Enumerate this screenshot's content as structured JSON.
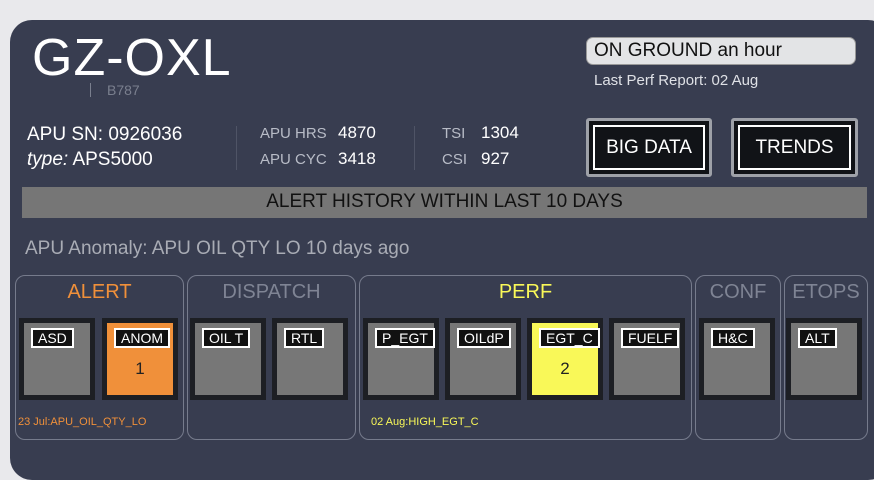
{
  "header": {
    "registration": "GZ-OXL",
    "aircraft_type": "B787",
    "flight_status": "ON GROUND an hour",
    "last_perf_report": "Last Perf Report: 02 Aug"
  },
  "apu": {
    "sn_label": "APU SN:",
    "sn_value": "0926036",
    "type_label": "type:",
    "type_value": "APS5000",
    "hrs_label": "APU HRS",
    "hrs_value": "4870",
    "cyc_label": "APU CYC",
    "cyc_value": "3418",
    "tsi_label": "TSI",
    "tsi_value": "1304",
    "csi_label": "CSI",
    "csi_value": "927"
  },
  "buttons": {
    "big_data": "BIG DATA",
    "trends": "TRENDS"
  },
  "alert_history": {
    "banner": "ALERT HISTORY WITHIN LAST 10 DAYS",
    "anomaly_text": "APU Anomaly: APU OIL QTY LO 10 days ago"
  },
  "groups": {
    "alert": {
      "title": "ALERT",
      "footer": "23 Jul:APU_OIL_QTY_LO",
      "title_color": "#f0903a"
    },
    "dispatch": {
      "title": "DISPATCH"
    },
    "perf": {
      "title": "PERF",
      "footer": "02 Aug:HIGH_EGT_C",
      "title_color": "#f9f858"
    },
    "conf": {
      "title": "CONF"
    },
    "etops": {
      "title": "ETOPS"
    }
  },
  "tiles": {
    "asd": {
      "label": "ASD"
    },
    "anom": {
      "label": "ANOM",
      "count": "1"
    },
    "oil_t": {
      "label": "OIL T"
    },
    "rtl": {
      "label": "RTL"
    },
    "p_egt": {
      "label": "P_EGT"
    },
    "oildp": {
      "label": "OILdP"
    },
    "egt_c": {
      "label": "EGT_C",
      "count": "2"
    },
    "fuelf": {
      "label": "FUELF"
    },
    "hc": {
      "label": "H&C"
    },
    "alt": {
      "label": "ALT"
    }
  }
}
